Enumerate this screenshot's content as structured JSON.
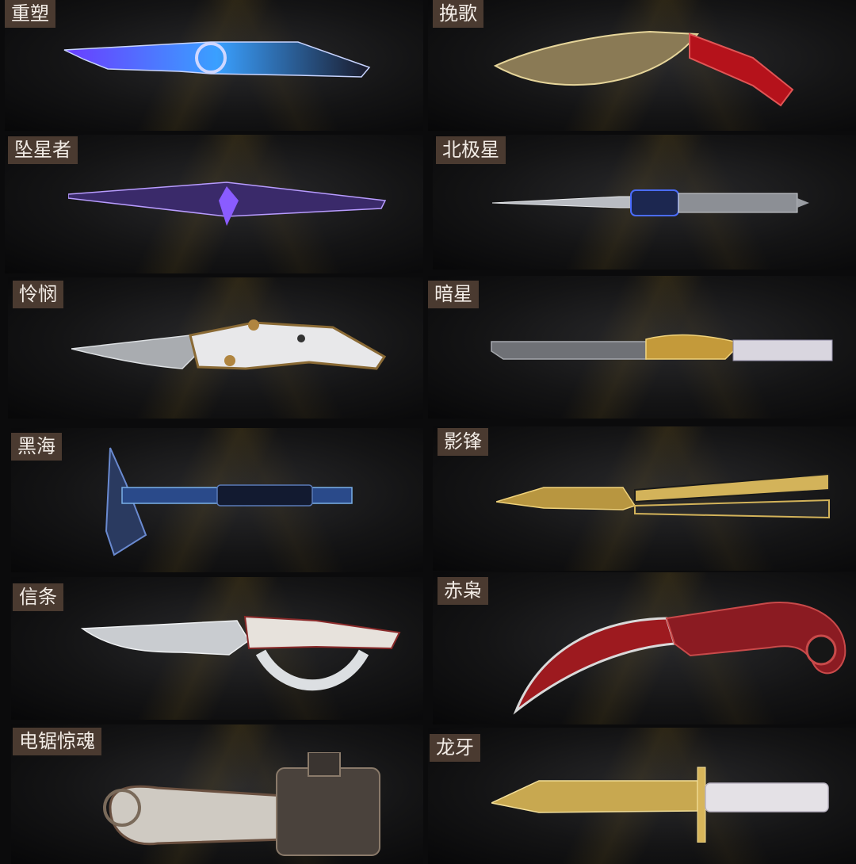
{
  "items": [
    {
      "name": "重塑"
    },
    {
      "name": "挽歌"
    },
    {
      "name": "坠星者"
    },
    {
      "name": "北极星"
    },
    {
      "name": "怜悯"
    },
    {
      "name": "暗星"
    },
    {
      "name": "黑海"
    },
    {
      "name": "影锋"
    },
    {
      "name": "信条"
    },
    {
      "name": "赤枭"
    },
    {
      "name": "电锯惊魂"
    },
    {
      "name": "龙牙"
    }
  ],
  "icons": [
    "nexus-knife-icon",
    "kukri-knife-icon",
    "starfall-dagger-icon",
    "polaris-dagger-icon",
    "mercy-folding-knife-icon",
    "darkstar-knife-icon",
    "tomahawk-axe-icon",
    "butterfly-knife-icon",
    "knuckle-knife-icon",
    "karambit-icon",
    "chainsaw-icon",
    "bayonet-icon"
  ],
  "colors": {
    "label_bg": "#4a3a30",
    "label_text": "#f2ece6",
    "background": "#0b0b0c"
  }
}
